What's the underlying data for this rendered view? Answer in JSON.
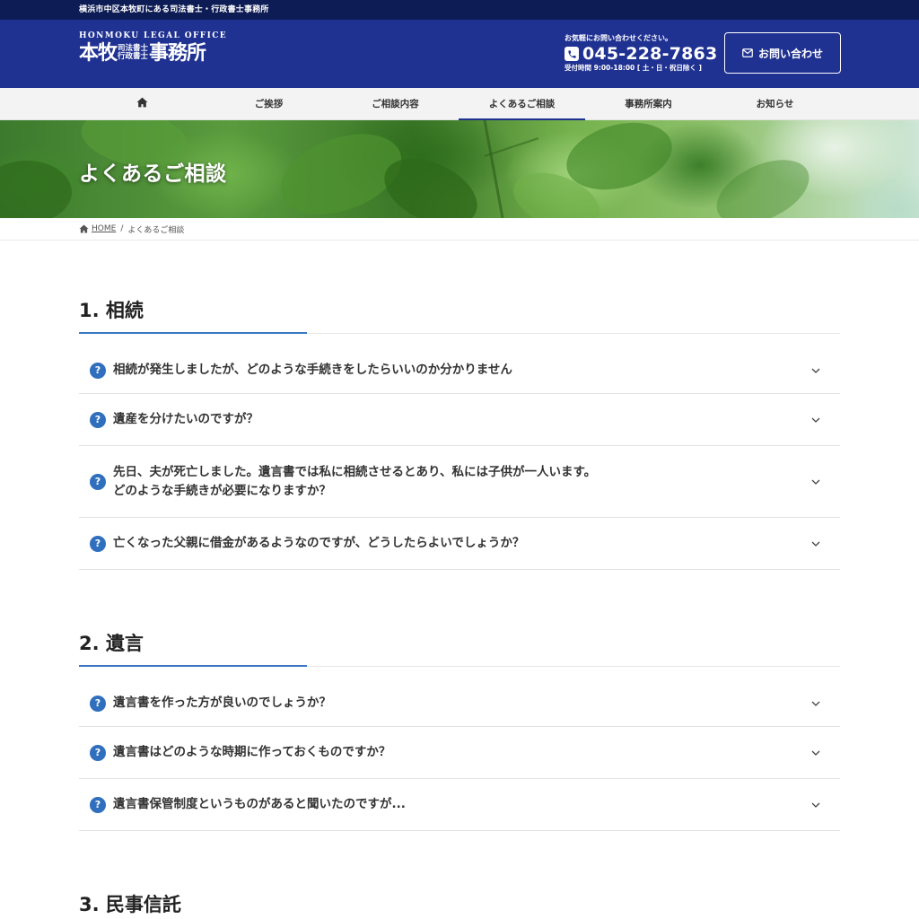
{
  "topbar": {
    "text": "横浜市中区本牧町にある司法書士・行政書士事務所"
  },
  "logo": {
    "en": "HONMOKU LEGAL OFFICE",
    "name1": "本牧",
    "sub1": "司法書士",
    "sub2": "行政書士",
    "name2": "事務所"
  },
  "contact": {
    "lead": "お気軽にお問い合わせください。",
    "phone": "045-228-7863",
    "hours": "受付時間 9:00-18:00 [ 土・日・祝日除く ]",
    "button_label": "お問い合わせ"
  },
  "nav": {
    "items": [
      {
        "label": ""
      },
      {
        "label": "ご挨拶"
      },
      {
        "label": "ご相談内容"
      },
      {
        "label": "よくあるご相談"
      },
      {
        "label": "事務所案内"
      },
      {
        "label": "お知らせ"
      }
    ]
  },
  "hero": {
    "title": "よくあるご相談"
  },
  "breadcrumb": {
    "home": "HOME",
    "sep": "/",
    "current": "よくあるご相談"
  },
  "sections": [
    {
      "title": "1. 相続",
      "items": [
        {
          "lines": [
            "相続が発生しましたが、どのような手続きをしたらいいのか分かりません"
          ]
        },
        {
          "lines": [
            "遺産を分けたいのですが？"
          ]
        },
        {
          "lines": [
            "先日、夫が死亡しました。遺言書では私に相続させるとあり、私には子供が一人います。",
            "どのような手続きが必要になりますか？"
          ]
        },
        {
          "lines": [
            "亡くなった父親に借金があるようなのですが、どうしたらよいでしょうか？"
          ]
        }
      ]
    },
    {
      "title": "2. 遺言",
      "items": [
        {
          "lines": [
            "遺言書を作った方が良いのでしょうか？"
          ]
        },
        {
          "lines": [
            "遺言書はどのような時期に作っておくものですか？"
          ]
        },
        {
          "lines": [
            "遺言書保管制度というものがあると聞いたのですが..."
          ]
        }
      ]
    },
    {
      "title": "3. 民事信託",
      "items": []
    }
  ],
  "icons": {
    "home": "home-icon",
    "phone": "phone-icon",
    "mail": "mail-icon",
    "question": "question-icon",
    "chevron": "chevron-down-icon"
  },
  "colors": {
    "header": "#1f3191",
    "topbar": "#0e1c55",
    "accent": "#3a78c2",
    "question": "#2f6fbd"
  }
}
